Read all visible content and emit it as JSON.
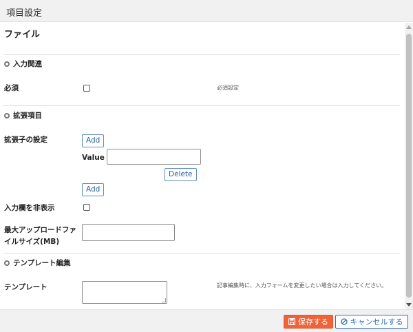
{
  "window": {
    "title": "項目設定"
  },
  "file": {
    "heading": "ファイル"
  },
  "sections": {
    "input": {
      "title": "入力関連",
      "icon": "gear-icon"
    },
    "extension": {
      "title": "拡張項目",
      "icon": "gear-icon"
    },
    "template": {
      "title": "テンプレート編集",
      "icon": "gear-icon"
    }
  },
  "fields": {
    "required": {
      "label": "必須",
      "checked": false,
      "hint": "必須設定"
    },
    "ext_setting": {
      "label": "拡張子の設定",
      "add_label": "Add",
      "value_label": "Value",
      "value": "",
      "delete_label": "Delete",
      "add_label_2": "Add"
    },
    "hide_input": {
      "label": "入力欄を非表示",
      "checked": false
    },
    "max_upload": {
      "label_line1": "最大アップロードファ",
      "label_line2": "イルサイズ(MB)",
      "value": ""
    },
    "template": {
      "label": "テンプレート",
      "value": "",
      "hint": "記事編集時に、入力フォームを変更したい場合は入力してください。"
    }
  },
  "footer": {
    "save_label": "保存する",
    "save_icon": "save-icon",
    "cancel_label": "キャンセルする",
    "cancel_icon": "cancel-icon"
  },
  "colors": {
    "save": "#f0623a",
    "cancel": "#2f6cb3",
    "link": "#2d5e94"
  }
}
